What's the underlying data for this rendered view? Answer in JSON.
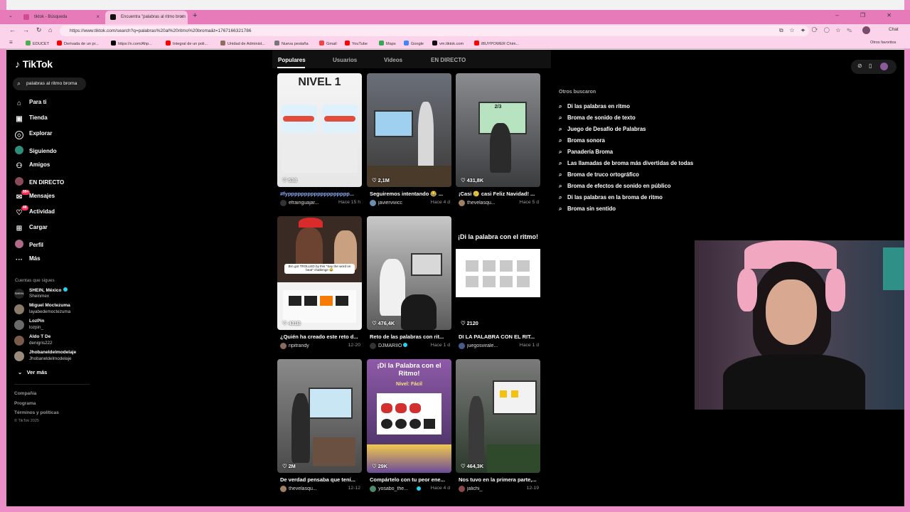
{
  "browser": {
    "tabs": [
      {
        "label": "tiktok - Búsqueda",
        "close": "×"
      },
      {
        "label": "Encuentra \"palabras al ritmo brom",
        "close": "×"
      }
    ],
    "new_tab": "+",
    "tab_menu": "⌄",
    "window_controls": "– ❐ ✕",
    "url": "https://www.tiktok.com/search?q=palabras%20al%20ritmo%20broma&t=1767166321786",
    "chat_label": "Chat",
    "bookmarks": [
      "EDUCET",
      "Derivada de un pr...",
      "https://x.com/Ahp...",
      "Integral de un poli...",
      "Unidad de Administ...",
      "Nueva pestaña",
      "Gmail",
      "YouTube",
      "Maps",
      "Google",
      "vm.tiktok.com",
      "iBUYPOWER Chim..."
    ],
    "other_favorites": "Otros favoritos",
    "colors": {
      "frame": "#ec8fc6",
      "tabbar": "#e77ab8"
    }
  },
  "sidebar": {
    "logo": "TikTok",
    "search_value": "palabras al ritmo broma",
    "nav": [
      {
        "label": "Para ti",
        "icon": "home-icon"
      },
      {
        "label": "Tienda",
        "icon": "shop-icon"
      },
      {
        "label": "Explorar",
        "icon": "compass-icon"
      },
      {
        "label": "Siguiendo",
        "icon": "following-icon"
      },
      {
        "label": "Amigos",
        "icon": "friends-icon"
      },
      {
        "label": "EN DIRECTO",
        "icon": "live-icon"
      },
      {
        "label": "Mensajes",
        "icon": "messages-icon",
        "badge": "99+"
      },
      {
        "label": "Actividad",
        "icon": "activity-icon",
        "badge": "48"
      },
      {
        "label": "Cargar",
        "icon": "upload-icon"
      },
      {
        "label": "Perfil",
        "icon": "profile-icon"
      },
      {
        "label": "Más",
        "icon": "more-icon"
      }
    ],
    "following_title": "Cuentas que sigues",
    "accounts": [
      {
        "name": "SHEIN, México",
        "handle": "Sheinmex",
        "verified": true
      },
      {
        "name": "Miguel Moctezuma",
        "handle": "layabedemoctezuma"
      },
      {
        "name": "LozPin",
        "handle": "lozpin_"
      },
      {
        "name": "Aldo T De",
        "handle": "denigris222"
      },
      {
        "name": "Jhobaneldelmodelaje",
        "handle": "Jhobaneldelmodelaje"
      }
    ],
    "see_more": "Ver más",
    "footer": [
      "Compañía",
      "Programa",
      "Términos y políticas"
    ],
    "copyright": "© TikTok 2025"
  },
  "search_tabs": [
    "Populares",
    "Usuarios",
    "Videos",
    "EN DIRECTO"
  ],
  "videos": [
    {
      "caption": "#fyppppppppppppppppppp...",
      "user": "efrainguajar...",
      "date": "Hace 15 h",
      "likes": "538",
      "overlay": "NIVEL 1"
    },
    {
      "caption": "Seguiremos intentando 😂 ...",
      "user": "javiervivicc",
      "date": "Hace 4 d",
      "likes": "2,1M",
      "overlay": ""
    },
    {
      "caption": "¡Casi 🥲 casi Feliz Navidad! ...",
      "user": "thevelasqu...",
      "date": "Hace 5 d",
      "likes": "431,8K",
      "overlay": "2/3"
    },
    {
      "caption": "¿Quién ha creado este reto d...",
      "user": "ripitrandy",
      "date": "12-20",
      "likes": "431B",
      "overlay": "Bro got TROLLED by this \"Say the word on beat\" challenge 😂"
    },
    {
      "caption": "Reto de las palabras con rit...",
      "user": "DJMARIIO",
      "date": "Hace 1 d",
      "likes": "476,4K",
      "overlay": "",
      "verified": true
    },
    {
      "caption": "DI LA PALABRA CON EL RIT...",
      "user": "juegosvirale...",
      "date": "Hace 1 d",
      "likes": "2120",
      "overlay": "¡Di la palabra con el ritmo!"
    },
    {
      "caption": "De verdad pensaba que tení...",
      "user": "thevelasqu...",
      "date": "12-12",
      "likes": "2M",
      "overlay": ""
    },
    {
      "caption": "Compártelo con tu peor ene...",
      "user": "yosabo_the...",
      "date": "Hace 4 d",
      "likes": "29K",
      "overlay": "¡Di la Palabra con el Ritmo!",
      "overlay2": "Nivel: Fácil",
      "verified": true
    },
    {
      "caption": "Nos tuvo en la primera parte,...",
      "user": "jalichi_",
      "date": "12-19",
      "likes": "464,3K",
      "overlay": ""
    }
  ],
  "others": {
    "title": "Otros buscaron",
    "items": [
      "Di las palabras en ritmo",
      "Broma de sonido de texto",
      "Juego de Desafío de Palabras",
      "Broma sonora",
      "Panadería Broma",
      "Las llamadas de broma más divertidas de todas",
      "Broma de truco ortográfico",
      "Broma de efectos de sonido en público",
      "Di las palabras en la broma de ritmo",
      "Broma sin sentido"
    ]
  }
}
